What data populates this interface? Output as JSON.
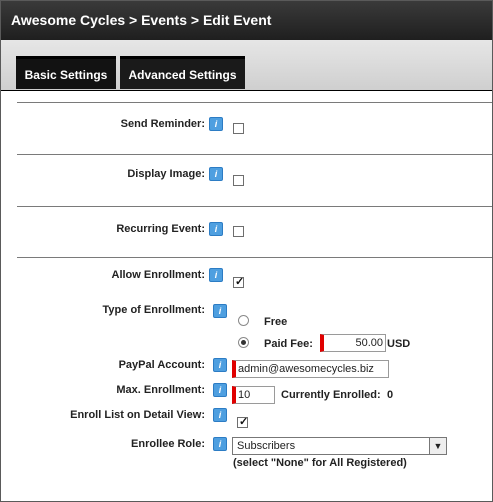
{
  "header": {
    "title": "Awesome Cycles > Events > Edit Event"
  },
  "tabs": [
    {
      "label": "Basic Settings"
    },
    {
      "label": "Advanced Settings"
    }
  ],
  "help_glyph": "i",
  "fields": {
    "send_reminder": {
      "label": "Send Reminder:",
      "checked": false
    },
    "display_image": {
      "label": "Display Image:",
      "checked": false
    },
    "recurring_event": {
      "label": "Recurring Event:",
      "checked": false
    },
    "allow_enrollment": {
      "label": "Allow Enrollment:",
      "checked": true
    },
    "type_of_enrollment": {
      "label": "Type of Enrollment:",
      "options": [
        {
          "label": "Free",
          "selected": false
        },
        {
          "label": "Paid Fee:",
          "selected": true
        }
      ],
      "fee_value": "50.00",
      "currency": "USD"
    },
    "paypal_account": {
      "label": "PayPal Account:",
      "value": "admin@awesomecycles.biz"
    },
    "max_enrollment": {
      "label": "Max. Enrollment:",
      "value": "10",
      "currently_enrolled_label": "Currently Enrolled:",
      "currently_enrolled_value": "0"
    },
    "enroll_list": {
      "label": "Enroll List on Detail View:",
      "checked": true
    },
    "enrollee_role": {
      "label": "Enrollee Role:",
      "value": "Subscribers",
      "note": "(select \"None\" for All Registered)"
    }
  },
  "colors": {
    "header_bg": "#1f1f1f",
    "help_icon": "#4e9fe0",
    "required_marker": "#e00000"
  }
}
